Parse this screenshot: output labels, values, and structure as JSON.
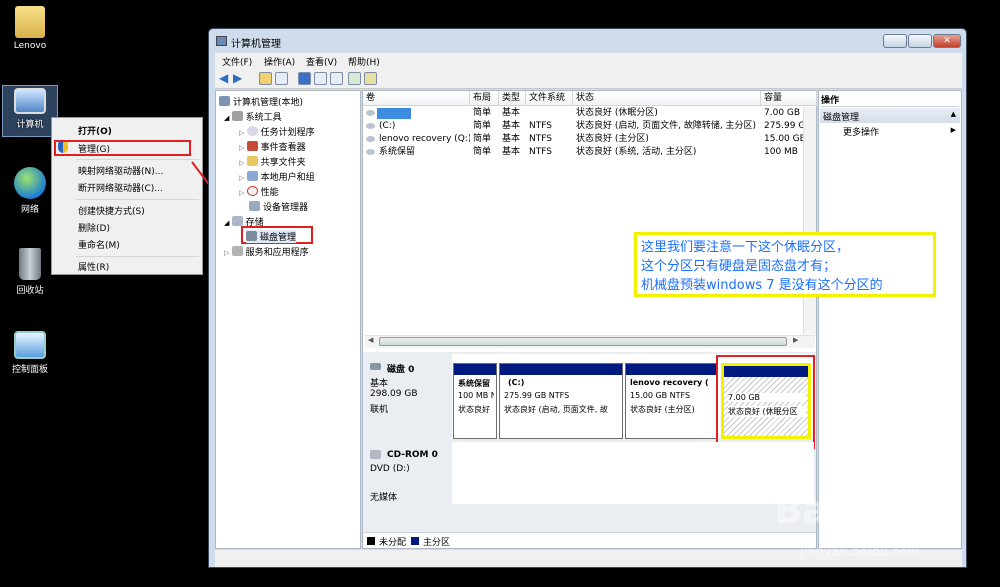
{
  "desktop": {
    "icons": [
      {
        "label": "Lenovo",
        "icon": "folder-icon"
      },
      {
        "label": "计算机",
        "icon": "computer-icon"
      },
      {
        "label": "网络",
        "icon": "network-icon"
      },
      {
        "label": "回收站",
        "icon": "recycle-bin-icon"
      },
      {
        "label": "控制面板",
        "icon": "control-panel-icon"
      }
    ]
  },
  "context_menu": {
    "items": [
      "打开(O)",
      "管理(G)",
      "映射网络驱动器(N)...",
      "断开网络驱动器(C)...",
      "创建快捷方式(S)",
      "删除(D)",
      "重命名(M)",
      "属性(R)"
    ]
  },
  "window": {
    "title": "计算机管理",
    "menu": [
      "文件(F)",
      "操作(A)",
      "查看(V)",
      "帮助(H)"
    ],
    "tree": {
      "root": "计算机管理(本地)",
      "system_tools": "系统工具",
      "children": [
        "任务计划程序",
        "事件查看器",
        "共享文件夹",
        "本地用户和组",
        "性能",
        "设备管理器"
      ],
      "storage": "存储",
      "disk_mgmt": "磁盘管理",
      "services": "服务和应用程序"
    },
    "volume_table": {
      "headers": [
        "卷",
        "布局",
        "类型",
        "文件系统",
        "状态",
        "容量"
      ],
      "rows": [
        {
          "vol": "",
          "layout": "简单",
          "type": "基本",
          "fs": "",
          "status": "状态良好 (休眠分区)",
          "size": "7.00 GB"
        },
        {
          "vol": "(C:)",
          "layout": "简单",
          "type": "基本",
          "fs": "NTFS",
          "status": "状态良好 (启动, 页面文件, 故障转储, 主分区)",
          "size": "275.99 GB"
        },
        {
          "vol": "lenovo recovery (Q:)",
          "layout": "简单",
          "type": "基本",
          "fs": "NTFS",
          "status": "状态良好 (主分区)",
          "size": "15.00 GB"
        },
        {
          "vol": "系统保留",
          "layout": "简单",
          "type": "基本",
          "fs": "NTFS",
          "status": "状态良好 (系统, 活动, 主分区)",
          "size": "100 MB"
        }
      ]
    },
    "disk0": {
      "name": "磁盘 0",
      "kind": "基本",
      "size": "298.09 GB",
      "state": "联机",
      "partitions": [
        {
          "name": "系统保留",
          "size": "100 MB NTFS",
          "status": "状态良好"
        },
        {
          "name": "(C:)",
          "size": "275.99 GB NTFS",
          "status": "状态良好 (启动, 页面文件, 故"
        },
        {
          "name": "lenovo recovery  (",
          "size": "15.00 GB NTFS",
          "status": "状态良好 (主分区)"
        },
        {
          "name": "",
          "size": "7.00 GB",
          "status": "状态良好 (休眠分区"
        }
      ]
    },
    "cdrom": {
      "name": "CD-ROM 0",
      "drive": "DVD (D:)",
      "media": "无媒体"
    },
    "legend": [
      "未分配",
      "主分区"
    ],
    "actions": {
      "header": "操作",
      "section": "磁盘管理",
      "more": "更多操作"
    }
  },
  "annotation": {
    "lines": [
      "这里我们要注意一下这个休眠分区，",
      "这个分区只有硬盘是固态盘才有；",
      "机械盘预装windows 7 是没有这个分区的"
    ]
  },
  "watermark": {
    "site": "jingyan.baidu.com"
  },
  "colors": {
    "primary_partition": "#001a80",
    "annotation_text": "#1a6fff",
    "highlight_red": "#e02020",
    "highlight_yellow": "#f2f200"
  }
}
